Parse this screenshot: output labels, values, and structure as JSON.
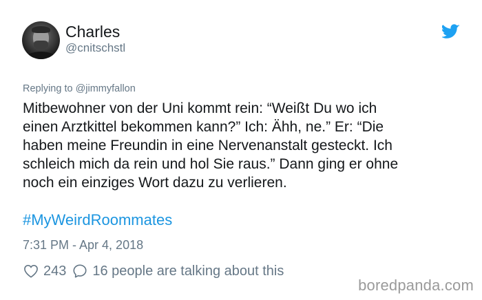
{
  "author": {
    "display_name": "Charles",
    "handle": "@cnitschstl",
    "avatar_icon": "avatar-photo"
  },
  "brand": {
    "icon": "twitter-bird-icon",
    "color": "#1da1f2"
  },
  "tweet": {
    "replying_to": "Replying to @jimmyfallon",
    "lines": [
      "Mitbewohner von der Uni kommt rein: “Weißt Du wo ich",
      "einen Arztkittel bekommen kann?” Ich: Ähh, ne.” Er: “Die",
      "haben meine Freundin in eine Nervenanstalt gesteckt. Ich",
      "schleich mich da rein und hol Sie raus.” Dann ging er ohne",
      "noch ein einziges Wort dazu zu verlieren."
    ],
    "hashtag": "#MyWeirdRoommates",
    "hashtag_color": "#1b95e0",
    "timestamp": "7:31 PM - Apr 4, 2018"
  },
  "actions": {
    "likes": "243",
    "like_icon": "heart-icon",
    "replies": "16 people are talking about this",
    "reply_icon": "comment-bubble-icon"
  },
  "watermark": {
    "text": "boredpanda.com"
  }
}
